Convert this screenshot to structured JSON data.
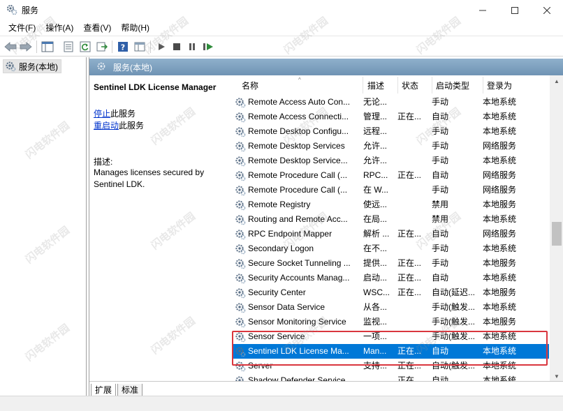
{
  "window": {
    "title": "服务",
    "controls": {
      "minimize": "—",
      "maximize": "☐",
      "close": "✕"
    }
  },
  "menu": {
    "items": [
      {
        "label": "文件(F)"
      },
      {
        "label": "操作(A)"
      },
      {
        "label": "查看(V)"
      },
      {
        "label": "帮助(H)"
      }
    ]
  },
  "toolbar": {
    "icons": [
      "back-icon",
      "forward-icon",
      "show-tree-icon",
      "properties-icon",
      "refresh-icon",
      "export-icon",
      "help-icon",
      "view-icon",
      "start-icon",
      "stop-icon",
      "pause-icon",
      "restart-icon"
    ]
  },
  "tree": {
    "node_label": "服务(本地)"
  },
  "pane": {
    "header": "服务(本地)",
    "service_title": "Sentinel LDK License Manager",
    "action_stop_link": "停止",
    "action_stop_suffix": "此服务",
    "action_restart_link": "重启动",
    "action_restart_suffix": "此服务",
    "desc_label": "描述:",
    "desc_text": "Manages licenses secured by Sentinel LDK."
  },
  "columns": {
    "name": "名称",
    "desc": "描述",
    "status": "状态",
    "start": "启动类型",
    "logon": "登录为"
  },
  "rows": [
    {
      "name": "Remote Access Auto Con...",
      "desc": "无论...",
      "status": "",
      "start": "手动",
      "logon": "本地系统"
    },
    {
      "name": "Remote Access Connecti...",
      "desc": "管理...",
      "status": "正在...",
      "start": "自动",
      "logon": "本地系统"
    },
    {
      "name": "Remote Desktop Configu...",
      "desc": "远程...",
      "status": "",
      "start": "手动",
      "logon": "本地系统"
    },
    {
      "name": "Remote Desktop Services",
      "desc": "允许...",
      "status": "",
      "start": "手动",
      "logon": "网络服务"
    },
    {
      "name": "Remote Desktop Service...",
      "desc": "允许...",
      "status": "",
      "start": "手动",
      "logon": "本地系统"
    },
    {
      "name": "Remote Procedure Call (...",
      "desc": "RPC...",
      "status": "正在...",
      "start": "自动",
      "logon": "网络服务"
    },
    {
      "name": "Remote Procedure Call (...",
      "desc": "在 W...",
      "status": "",
      "start": "手动",
      "logon": "网络服务"
    },
    {
      "name": "Remote Registry",
      "desc": "使远...",
      "status": "",
      "start": "禁用",
      "logon": "本地服务"
    },
    {
      "name": "Routing and Remote Acc...",
      "desc": "在局...",
      "status": "",
      "start": "禁用",
      "logon": "本地系统"
    },
    {
      "name": "RPC Endpoint Mapper",
      "desc": "解析 ...",
      "status": "正在...",
      "start": "自动",
      "logon": "网络服务"
    },
    {
      "name": "Secondary Logon",
      "desc": "在不...",
      "status": "",
      "start": "手动",
      "logon": "本地系统"
    },
    {
      "name": "Secure Socket Tunneling ...",
      "desc": "提供...",
      "status": "正在...",
      "start": "手动",
      "logon": "本地服务"
    },
    {
      "name": "Security Accounts Manag...",
      "desc": "启动...",
      "status": "正在...",
      "start": "自动",
      "logon": "本地系统"
    },
    {
      "name": "Security Center",
      "desc": "WSC...",
      "status": "正在...",
      "start": "自动(延迟...",
      "logon": "本地服务"
    },
    {
      "name": "Sensor Data Service",
      "desc": "从各...",
      "status": "",
      "start": "手动(触发...",
      "logon": "本地系统"
    },
    {
      "name": "Sensor Monitoring Service",
      "desc": "监视...",
      "status": "",
      "start": "手动(触发...",
      "logon": "本地服务"
    },
    {
      "name": "Sensor Service",
      "desc": "一项...",
      "status": "",
      "start": "手动(触发...",
      "logon": "本地系统"
    },
    {
      "name": "Sentinel LDK License Ma...",
      "desc": "Man...",
      "status": "正在...",
      "start": "自动",
      "logon": "本地系统",
      "selected": true
    },
    {
      "name": "Server",
      "desc": "支持...",
      "status": "正在...",
      "start": "自动(触发...",
      "logon": "本地系统"
    },
    {
      "name": "Shadow Defender Service",
      "desc": "",
      "status": "正在...",
      "start": "自动",
      "logon": "本地系统"
    }
  ],
  "tabs": [
    {
      "label": "扩展"
    },
    {
      "label": "标准"
    }
  ],
  "watermark": "闪电软件园",
  "colors": {
    "selection": "#0078d7",
    "highlight_box": "#d9363e",
    "header_band": "#7a9dbd"
  }
}
